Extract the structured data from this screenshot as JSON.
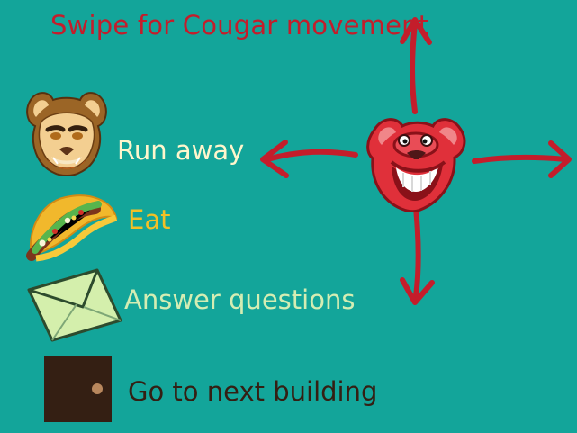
{
  "title": "Swipe for Cougar movement",
  "legend": [
    {
      "icon": "cougar-face-icon",
      "label": "Run away",
      "color": "#fff6cc"
    },
    {
      "icon": "taco-icon",
      "label": "Eat",
      "color": "#f4c026"
    },
    {
      "icon": "envelope-icon",
      "label": "Answer questions",
      "color": "#d4edb3"
    },
    {
      "icon": "door-icon",
      "label": "Go to next building",
      "color": "#341f13"
    }
  ],
  "colors": {
    "background": "#13a59a",
    "title": "#c41d2b",
    "arrow": "#c41d2b",
    "mascot": "#e0303a"
  },
  "controls": {
    "mascot_icon": "red-cougar-mascot-icon",
    "arrows": [
      "up-arrow-icon",
      "left-arrow-icon",
      "right-arrow-icon",
      "down-arrow-icon"
    ]
  }
}
